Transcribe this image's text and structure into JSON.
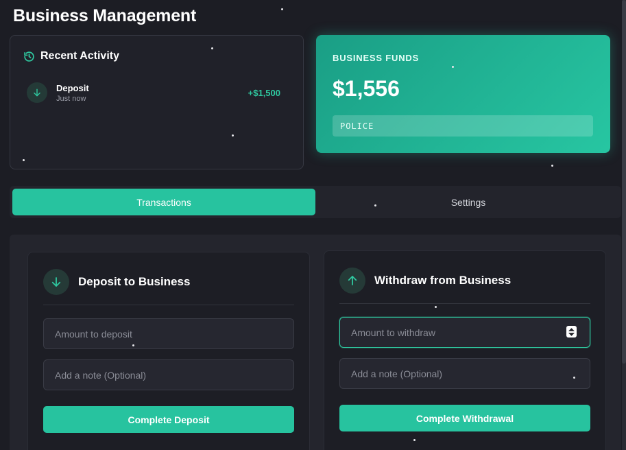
{
  "header": {
    "title": "Business Management"
  },
  "recent_activity": {
    "title": "Recent Activity",
    "icon": "history-icon",
    "items": [
      {
        "type": "Deposit",
        "time": "Just now",
        "amount": "+$1,500",
        "icon": "arrow-down-icon"
      }
    ]
  },
  "funds": {
    "label": "BUSINESS FUNDS",
    "amount": "$1,556",
    "business_name": "POLICE"
  },
  "tabs": [
    {
      "label": "Transactions",
      "active": true
    },
    {
      "label": "Settings",
      "active": false
    }
  ],
  "deposit": {
    "title": "Deposit to Business",
    "icon": "arrow-down-icon",
    "amount_placeholder": "Amount to deposit",
    "note_placeholder": "Add a note (Optional)",
    "button_label": "Complete Deposit"
  },
  "withdraw": {
    "title": "Withdraw from Business",
    "icon": "arrow-up-icon",
    "amount_placeholder": "Amount to withdraw",
    "note_placeholder": "Add a note (Optional)",
    "button_label": "Complete Withdrawal"
  },
  "colors": {
    "accent": "#27c39f",
    "background": "#1c1d24",
    "card": "#202129",
    "positive": "#2fc9a0"
  }
}
